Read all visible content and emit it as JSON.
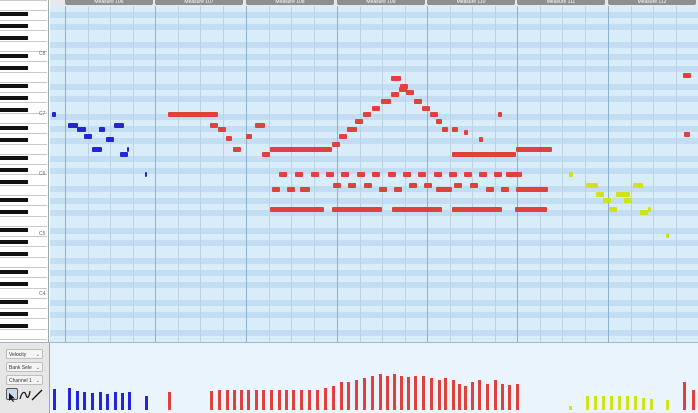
{
  "ruler": {
    "measures": [
      {
        "label": "Measure 106"
      },
      {
        "label": "Measure 107"
      },
      {
        "label": "Measure 108"
      },
      {
        "label": "Measure 109"
      },
      {
        "label": "Measure 110"
      },
      {
        "label": "Measure 111"
      },
      {
        "label": "Measure 112"
      }
    ]
  },
  "keyboard": {
    "octave_labels": [
      "C8",
      "C7",
      "C6",
      "C5",
      "C4",
      "C3"
    ]
  },
  "controls": {
    "parameter_select": "Velocity",
    "bank_select": "Bank Sele",
    "channel_select": "Channel 1"
  },
  "tools": [
    {
      "name": "pointer-tool-icon",
      "active": true
    },
    {
      "name": "curve-tool-icon",
      "active": false
    },
    {
      "name": "line-tool-icon",
      "active": false
    }
  ],
  "colors": {
    "blue": "#2424d8",
    "red": "#e0413c",
    "yellow": "#cfe21a"
  },
  "tracks": [
    {
      "id": "blue",
      "color": "#2424d8"
    },
    {
      "id": "red",
      "color": "#e0413c"
    },
    {
      "id": "yellow",
      "color": "#cfe21a"
    }
  ]
}
